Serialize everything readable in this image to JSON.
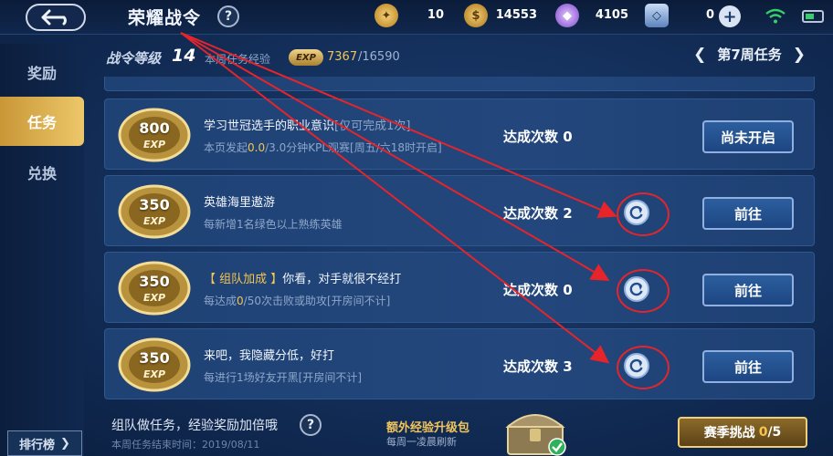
{
  "header": {
    "title": "荣耀战令",
    "help": "?",
    "resources": [
      {
        "icon": "feather-token-icon",
        "value": "10",
        "color": "#e8b33c"
      },
      {
        "icon": "gold-coin-icon",
        "value": "14553",
        "color": "#e0a83a"
      },
      {
        "icon": "diamond-icon",
        "value": "4105",
        "color": "#b07ce6"
      },
      {
        "icon": "coupon-icon",
        "value": "0",
        "color": "#7fa9e4"
      }
    ],
    "plus": "+"
  },
  "subheader": {
    "level_label": "战令等级",
    "level": "14",
    "week_exp_label": "本周任务经验",
    "exp_badge": "EXP",
    "exp_current": "7367",
    "exp_max": "/16590",
    "week_title": "第7周任务"
  },
  "sidebar": {
    "items": [
      {
        "label": "奖励",
        "active": false
      },
      {
        "label": "任务",
        "active": true
      },
      {
        "label": "兑换",
        "active": false
      }
    ],
    "rank_button": "排行榜"
  },
  "tasks": [
    {
      "exp": "800",
      "exp_unit": "EXP",
      "title": "学习世冠选手的职业意识",
      "title_suffix": "[仅可完成1次]",
      "desc_pre": "本页发起",
      "desc_hl": "0.0",
      "desc_post": "/3.0分钟KPL观赛[周五/六18时开启]",
      "count": "达成次数 0",
      "button": "尚未开启"
    },
    {
      "exp": "350",
      "exp_unit": "EXP",
      "title": "英雄海里遨游",
      "desc_pre": "每新增",
      "desc_hl": "",
      "desc_post": "1名绿色以上熟练英雄",
      "count": "达成次数 2",
      "button": "前往"
    },
    {
      "exp": "350",
      "exp_unit": "EXP",
      "tag": "【 组队加成 】",
      "title": "你看，对手就很不经打",
      "desc_pre": "每达成",
      "desc_hl": "0",
      "desc_post": "/50次击败或助攻[开房间不计]",
      "count": "达成次数 0",
      "button": "前往"
    },
    {
      "exp": "350",
      "exp_unit": "EXP",
      "title": "来吧，我隐藏分低，好打",
      "desc_pre": "每进行",
      "desc_hl": "",
      "desc_post": "1场好友开黑[开房间不计]",
      "count": "达成次数 3",
      "button": "前往"
    }
  ],
  "bottom": {
    "team_tip": "组队做任务，经验奖励加倍哦",
    "help": "?",
    "end_time": "本周任务结束时间：2019/08/11",
    "extra_title": "额外经验升级包",
    "extra_sub": "每周一凌晨刷新",
    "season_label": "赛季挑战",
    "season_progress": "0",
    "season_total": "/5"
  },
  "colors": {
    "accent_gold": "#f6c54e",
    "annotation_red": "#e6242a",
    "active_tab": "#d9ae4e"
  }
}
